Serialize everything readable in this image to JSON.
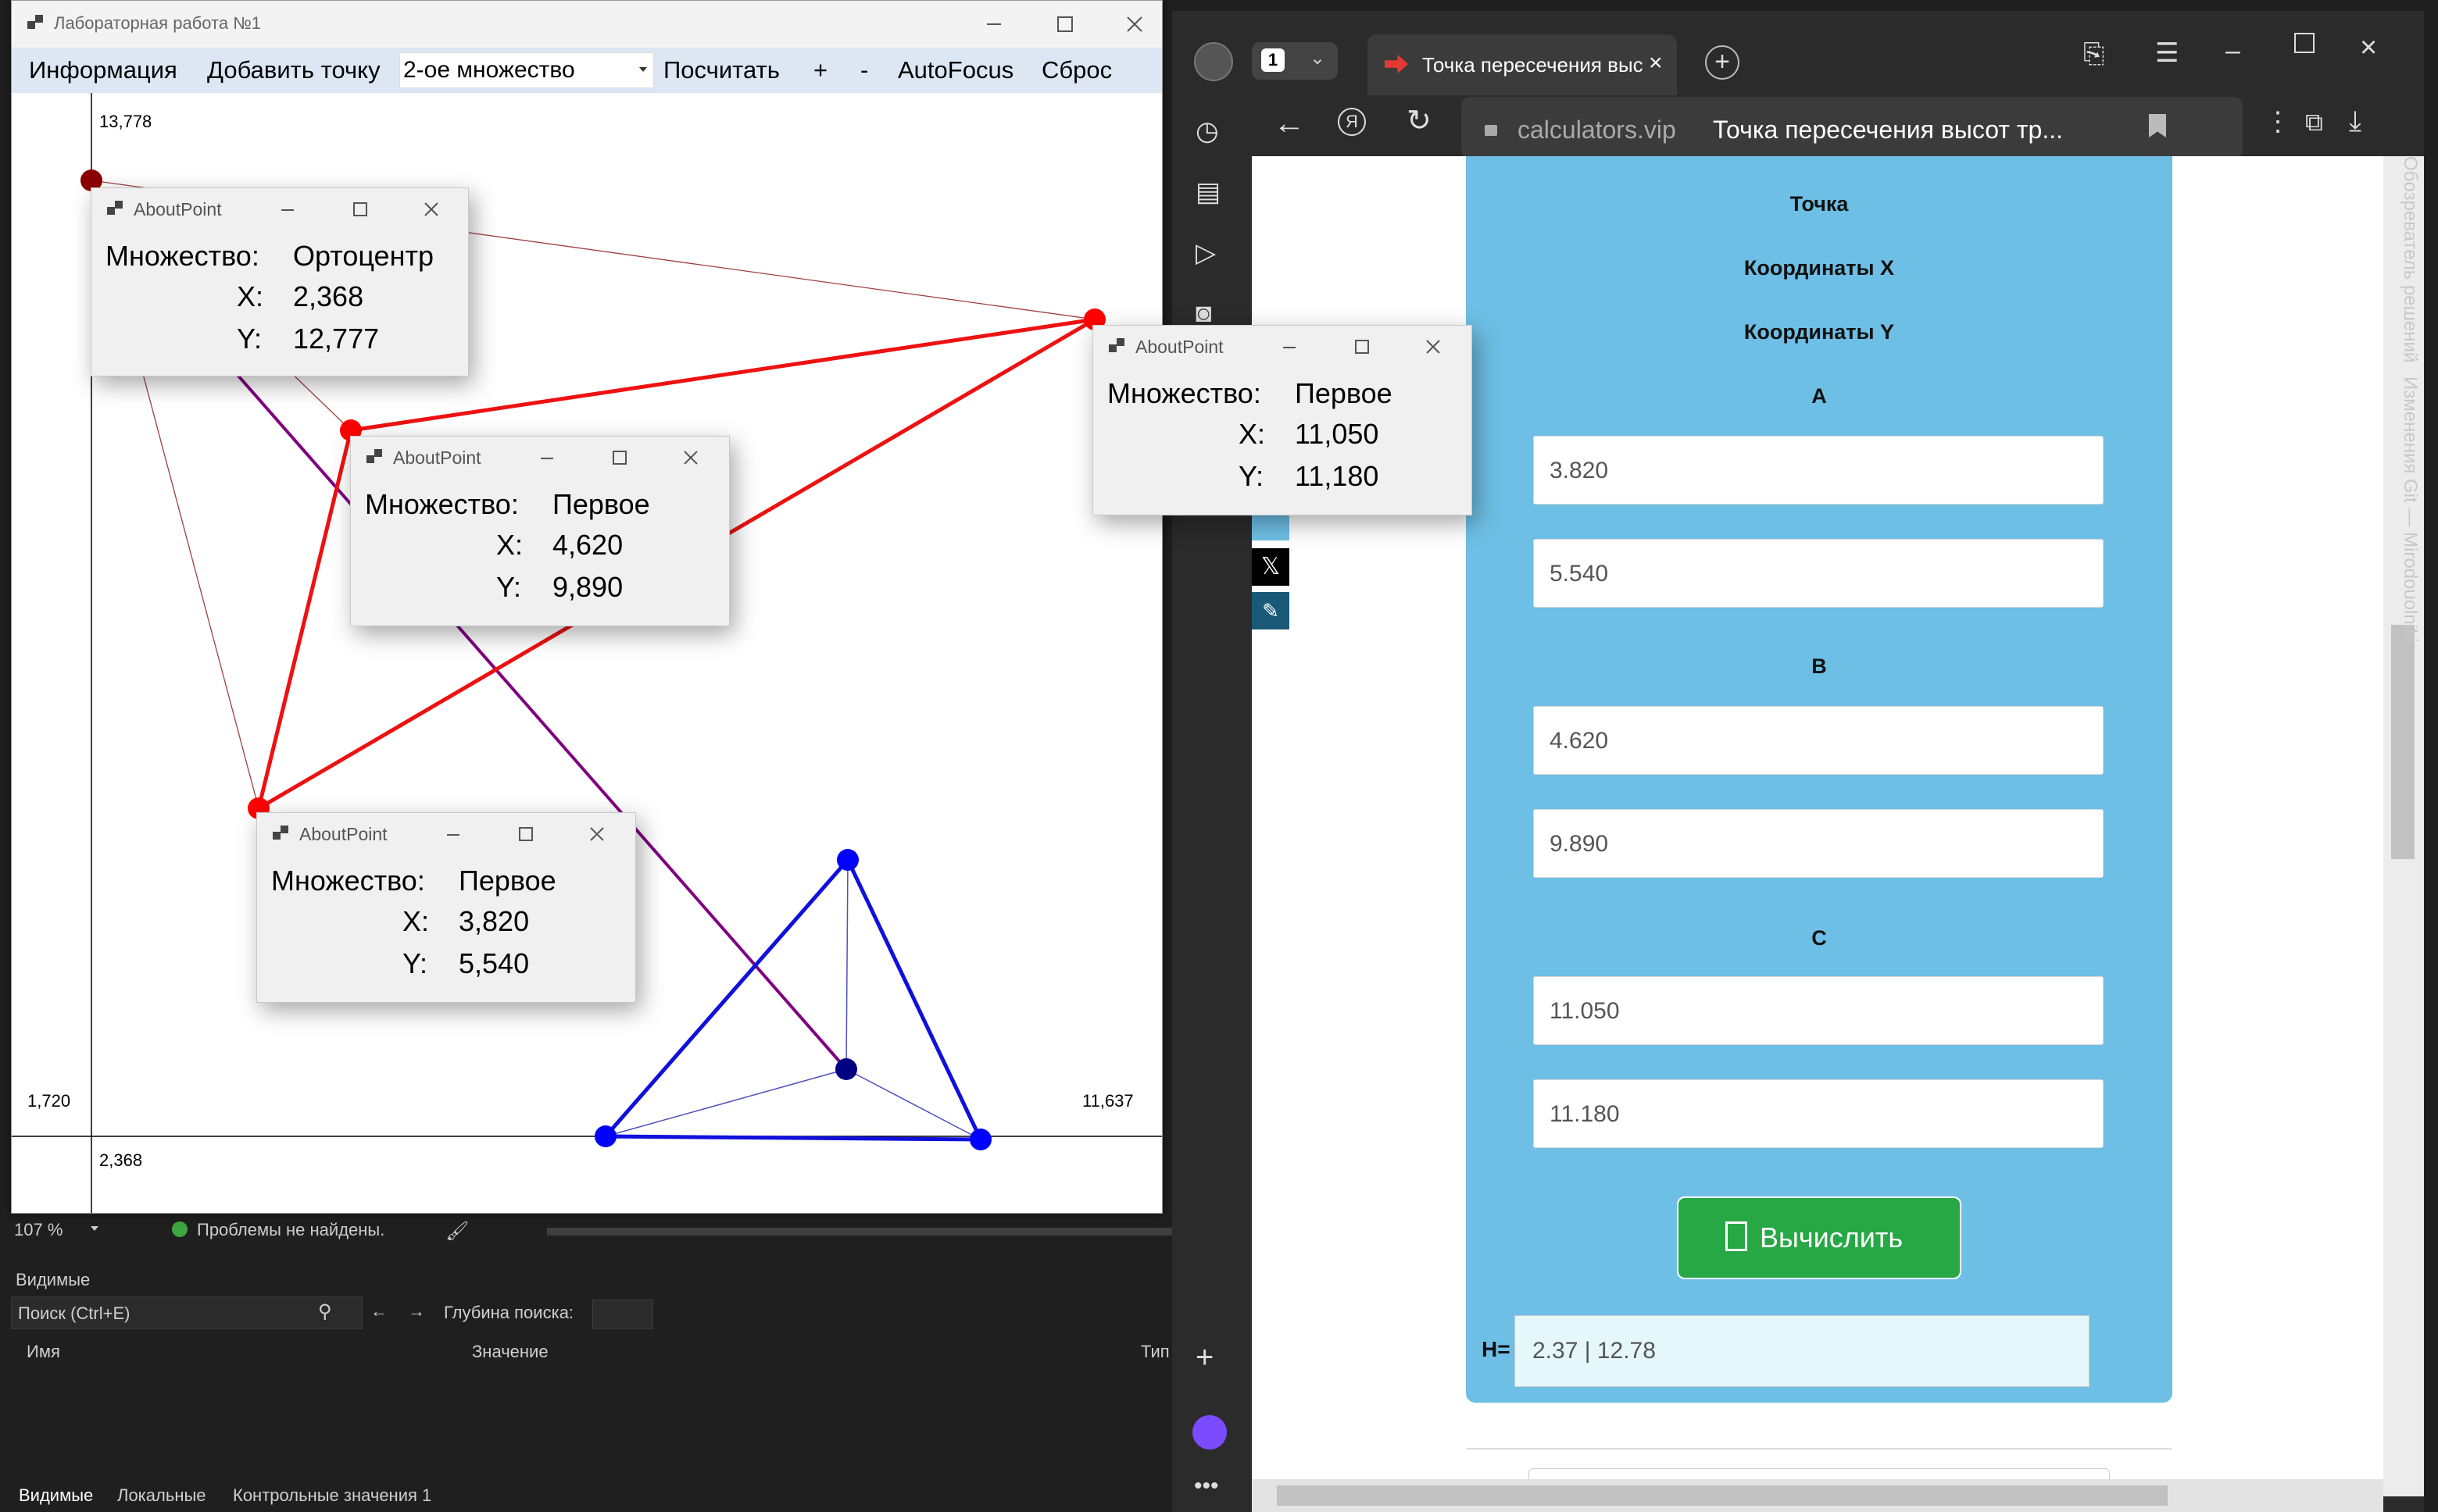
{
  "lab": {
    "title": "Лабораторная работа №1",
    "menu": {
      "info": "Информация",
      "add_point": "Добавить точку",
      "set_select": "2-ое множество",
      "compute": "Посчитать",
      "plus": "+",
      "minus": "-",
      "autofocus": "AutoFocus",
      "reset": "Сброс"
    },
    "axis_labels": {
      "y_top": "13,778",
      "y_bottom": "1,720",
      "x_right": "11,637",
      "x_origin": "2,368"
    },
    "popups": [
      {
        "title": "AboutPoint",
        "set_label": "Множество:",
        "set_value": "Ортоцентр",
        "x_label": "X:",
        "x_value": "2,368",
        "y_label": "Y:",
        "y_value": "12,777"
      },
      {
        "title": "AboutPoint",
        "set_label": "Множество:",
        "set_value": "Первое",
        "x_label": "X:",
        "x_value": "4,620",
        "y_label": "Y:",
        "y_value": "9,890"
      },
      {
        "title": "AboutPoint",
        "set_label": "Множество:",
        "set_value": "Первое",
        "x_label": "X:",
        "x_value": "3,820",
        "y_label": "Y:",
        "y_value": "5,540"
      },
      {
        "title": "AboutPoint",
        "set_label": "Множество:",
        "set_value": "Первое",
        "x_label": "X:",
        "x_value": "11,050",
        "y_label": "Y:",
        "y_value": "11,180"
      }
    ],
    "colors": {
      "set1": "#ff0000",
      "set2": "#0000ff",
      "orthocenter": "#8b0000",
      "altitude": "#800080"
    }
  },
  "vs": {
    "zoom": "107 %",
    "problems": "Проблемы не найдены.",
    "watch_title": "Видимые",
    "search_placeholder": "Поиск (Ctrl+E)",
    "depth_label": "Глубина поиска:",
    "col_name": "Имя",
    "col_value": "Значение",
    "col_type": "Тип",
    "bottom_tabs": [
      "Видимые",
      "Локальные",
      "Контрольные значения 1"
    ]
  },
  "browser": {
    "tab_count": "1",
    "tab_title": "Точка пересечения выс",
    "domain": "calculators.vip",
    "page_title": "Точка пересечения высот тр...",
    "side_text_1": "Обозреватель решений",
    "side_text_2": "Изменения Git — Mirodouolniki",
    "calc": {
      "point_label": "Точка",
      "coord_x_label": "Координаты X",
      "coord_y_label": "Координаты Y",
      "a_label": "A",
      "a_x": "3.820",
      "a_y": "5.540",
      "b_label": "B",
      "b_x": "4.620",
      "b_y": "9.890",
      "c_label": "C",
      "c_x": "11.050",
      "c_y": "11.180",
      "button": "Вычислить",
      "result_label": "H=",
      "result_value": "2.37 | 12.78"
    }
  }
}
